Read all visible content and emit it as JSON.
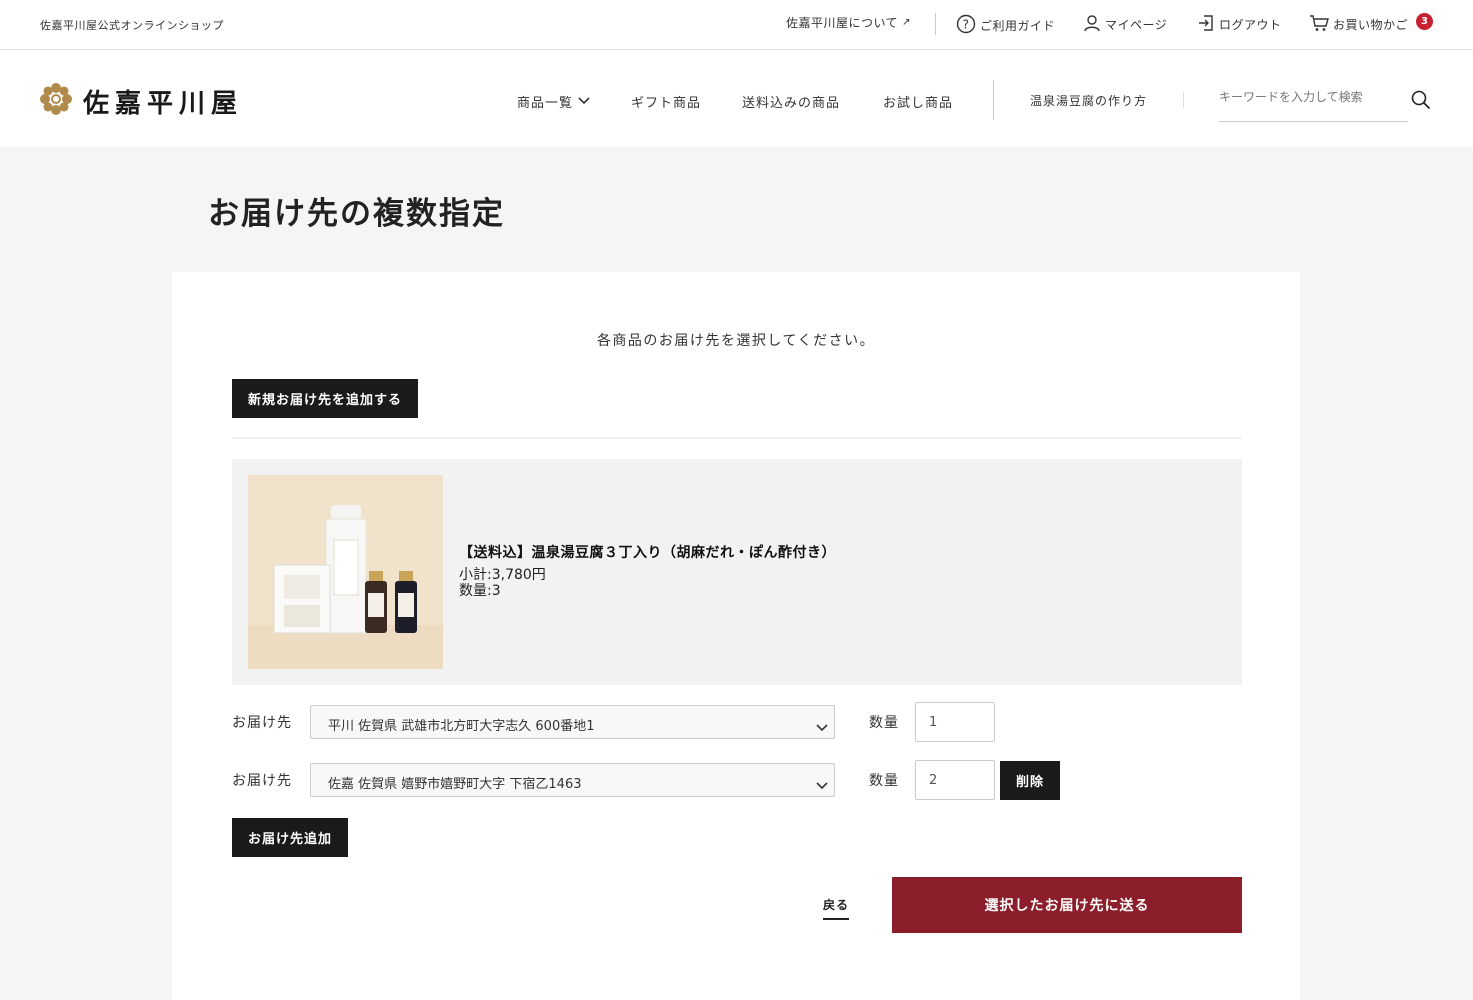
{
  "topbar": {
    "shop_name": "佐嘉平川屋公式オンラインショップ",
    "about": "佐嘉平川屋について",
    "guide": "ご利用ガイド",
    "mypage": "マイページ",
    "logout": "ログアウト",
    "cart": "お買い物かご",
    "cart_count": "3"
  },
  "header": {
    "logo_text": "佐嘉平川屋",
    "nav": [
      "商品一覧",
      "ギフト商品",
      "送料込みの商品",
      "お試し商品"
    ],
    "howto": "温泉湯豆腐の作り方",
    "search_placeholder": "キーワードを入力して検索"
  },
  "page": {
    "title": "お届け先の複数指定",
    "instruction": "各商品のお届け先を選択してください。",
    "add_new_address": "新規お届け先を追加する"
  },
  "product": {
    "name": "【送料込】温泉湯豆腐３丁入り（胡麻だれ・ぽん酢付き）",
    "subtotal": "小計:3,780円",
    "quantity": "数量:3"
  },
  "shipping_rows": [
    {
      "label": "お届け先",
      "address": "平川 佐賀県 武雄市北方町大字志久 600番地1",
      "qty_label": "数量",
      "qty": "1"
    },
    {
      "label": "お届け先",
      "address": "佐嘉 佐賀県 嬉野市嬉野町大字 下宿乙1463",
      "qty_label": "数量",
      "qty": "2",
      "delete": "削除"
    }
  ],
  "actions": {
    "add_destination": "お届け先追加",
    "back": "戻る",
    "submit": "選択したお届け先に送る"
  },
  "colors": {
    "accent": "#8c1d2a",
    "badge": "#c8202e",
    "dark_button": "#1a1a1a"
  }
}
